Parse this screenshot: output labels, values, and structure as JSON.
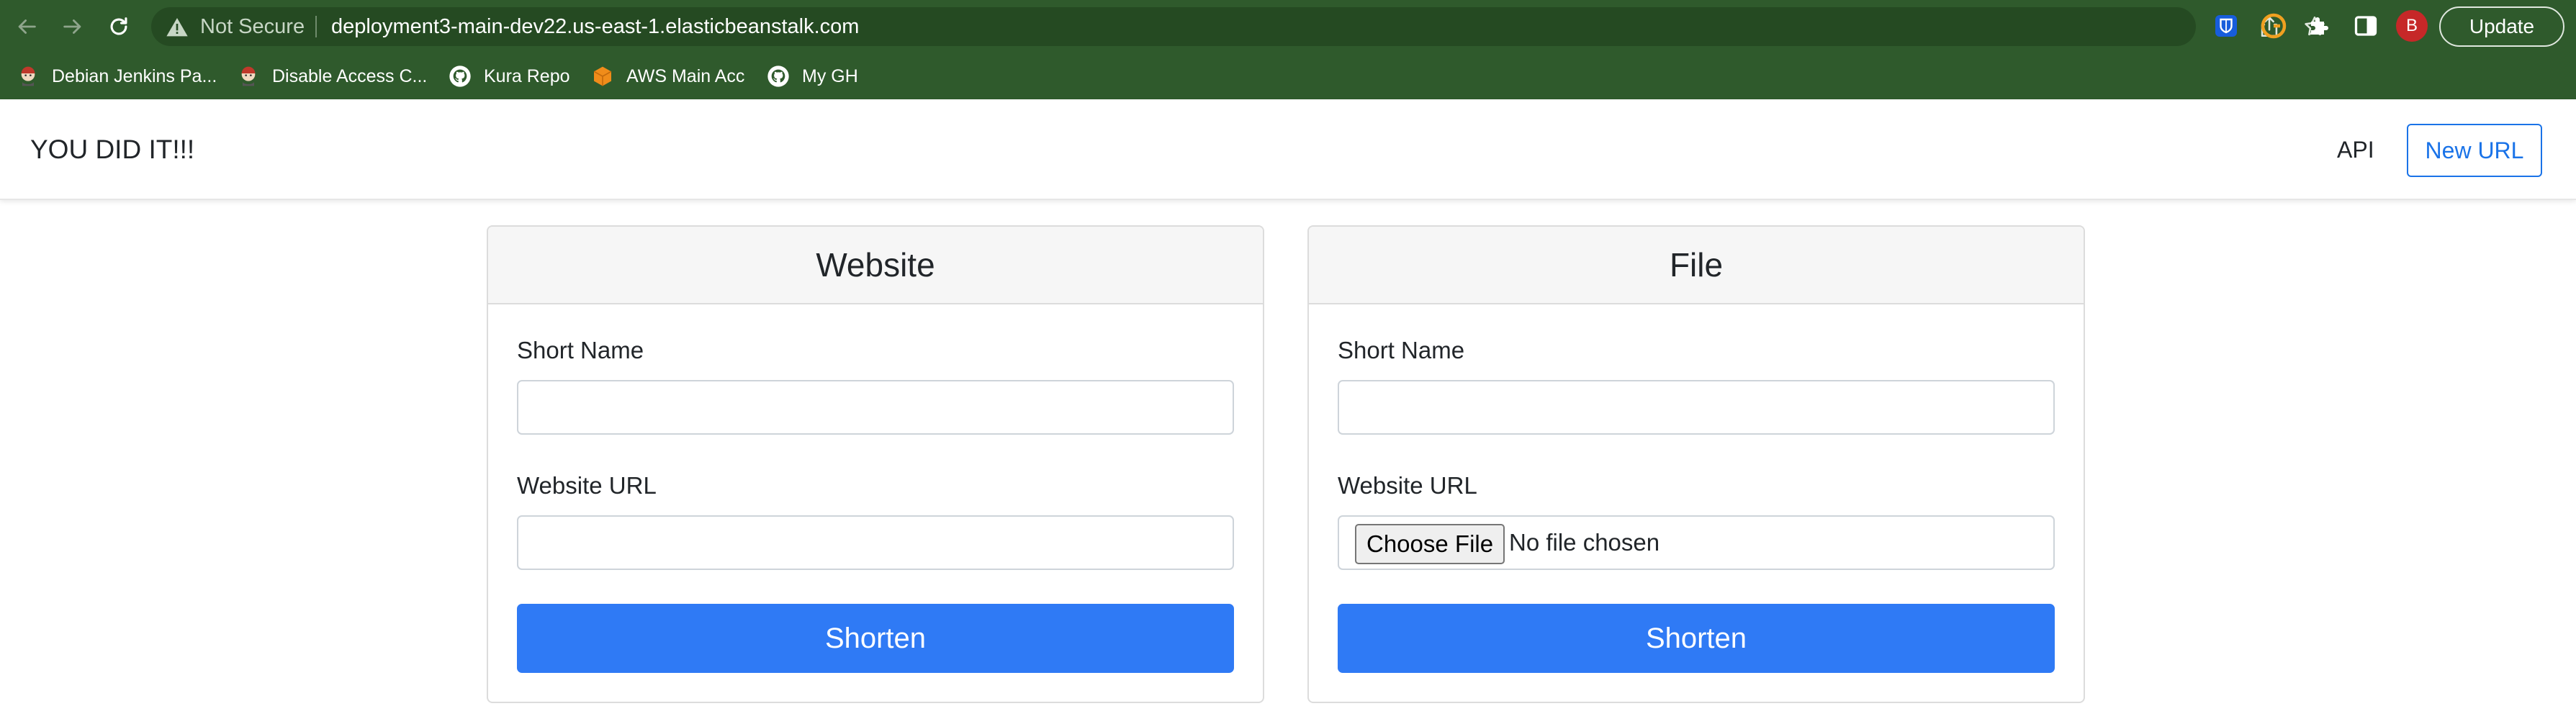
{
  "browser": {
    "omnibox": {
      "security_label": "Not Secure",
      "url": "deployment3-main-dev22.us-east-1.elasticbeanstalk.com"
    },
    "profile_initial": "B",
    "update_label": "Update",
    "bookmarks": [
      {
        "label": "Debian Jenkins Pa...",
        "icon": "jenkins-icon"
      },
      {
        "label": "Disable Access C...",
        "icon": "jenkins-icon"
      },
      {
        "label": "Kura Repo",
        "icon": "github-icon"
      },
      {
        "label": "AWS Main Acc",
        "icon": "aws-cube-icon"
      },
      {
        "label": "My GH",
        "icon": "github-icon"
      }
    ],
    "colors": {
      "chrome": "#2f5a2c",
      "omnibox": "#254a22"
    }
  },
  "navbar": {
    "brand": "YOU DID IT!!!",
    "api_link": "API",
    "new_url_button": "New URL"
  },
  "cards": {
    "website": {
      "title": "Website",
      "short_name_label": "Short Name",
      "url_label": "Website URL",
      "submit_label": "Shorten"
    },
    "file": {
      "title": "File",
      "short_name_label": "Short Name",
      "url_label": "Website URL",
      "choose_file_label": "Choose File",
      "no_file_text": "No file chosen",
      "submit_label": "Shorten"
    }
  },
  "colors": {
    "primary": "#2f7af5",
    "link": "#1a73e8"
  }
}
